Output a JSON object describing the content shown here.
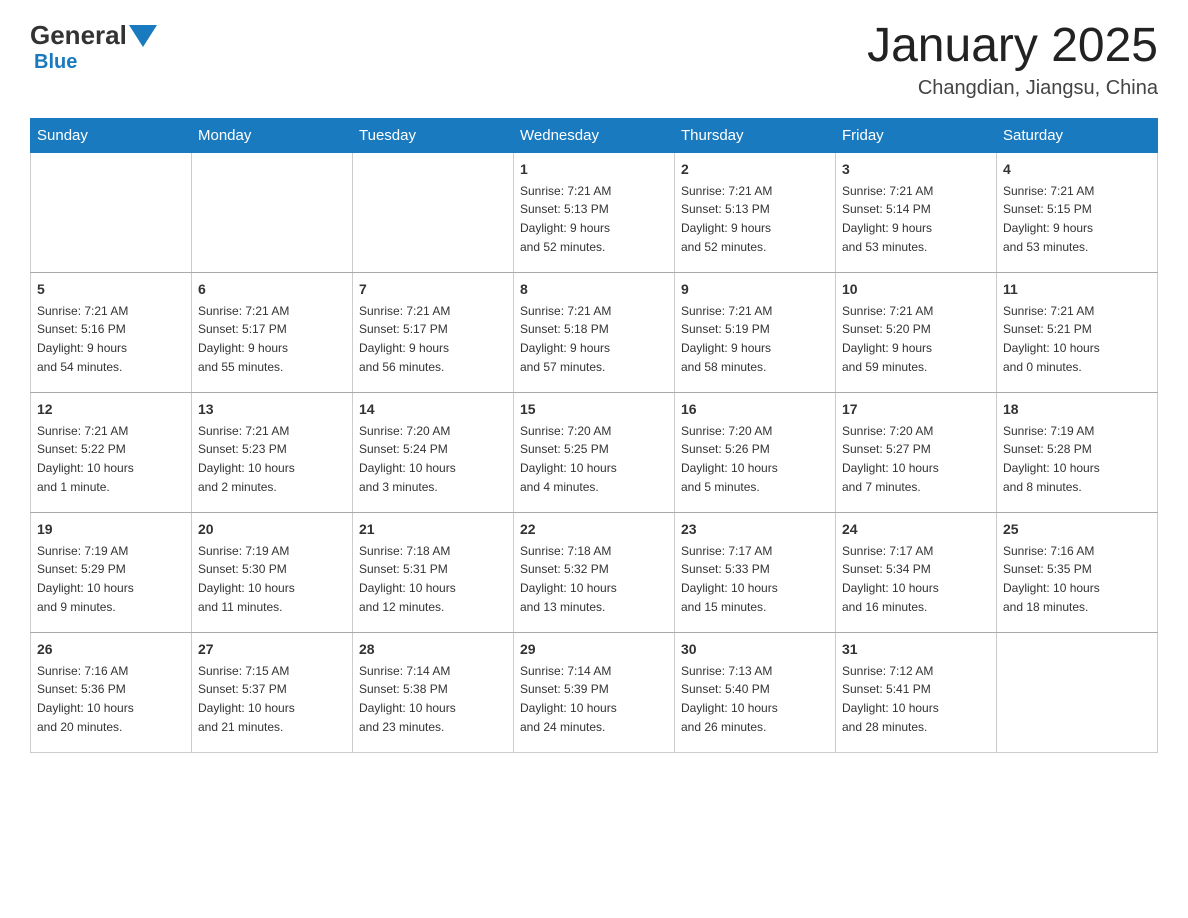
{
  "logo": {
    "text_general": "General",
    "text_blue": "Blue",
    "tagline": ""
  },
  "header": {
    "title": "January 2025",
    "subtitle": "Changdian, Jiangsu, China"
  },
  "days_of_week": [
    "Sunday",
    "Monday",
    "Tuesday",
    "Wednesday",
    "Thursday",
    "Friday",
    "Saturday"
  ],
  "weeks": [
    [
      {
        "day": "",
        "info": ""
      },
      {
        "day": "",
        "info": ""
      },
      {
        "day": "",
        "info": ""
      },
      {
        "day": "1",
        "info": "Sunrise: 7:21 AM\nSunset: 5:13 PM\nDaylight: 9 hours\nand 52 minutes."
      },
      {
        "day": "2",
        "info": "Sunrise: 7:21 AM\nSunset: 5:13 PM\nDaylight: 9 hours\nand 52 minutes."
      },
      {
        "day": "3",
        "info": "Sunrise: 7:21 AM\nSunset: 5:14 PM\nDaylight: 9 hours\nand 53 minutes."
      },
      {
        "day": "4",
        "info": "Sunrise: 7:21 AM\nSunset: 5:15 PM\nDaylight: 9 hours\nand 53 minutes."
      }
    ],
    [
      {
        "day": "5",
        "info": "Sunrise: 7:21 AM\nSunset: 5:16 PM\nDaylight: 9 hours\nand 54 minutes."
      },
      {
        "day": "6",
        "info": "Sunrise: 7:21 AM\nSunset: 5:17 PM\nDaylight: 9 hours\nand 55 minutes."
      },
      {
        "day": "7",
        "info": "Sunrise: 7:21 AM\nSunset: 5:17 PM\nDaylight: 9 hours\nand 56 minutes."
      },
      {
        "day": "8",
        "info": "Sunrise: 7:21 AM\nSunset: 5:18 PM\nDaylight: 9 hours\nand 57 minutes."
      },
      {
        "day": "9",
        "info": "Sunrise: 7:21 AM\nSunset: 5:19 PM\nDaylight: 9 hours\nand 58 minutes."
      },
      {
        "day": "10",
        "info": "Sunrise: 7:21 AM\nSunset: 5:20 PM\nDaylight: 9 hours\nand 59 minutes."
      },
      {
        "day": "11",
        "info": "Sunrise: 7:21 AM\nSunset: 5:21 PM\nDaylight: 10 hours\nand 0 minutes."
      }
    ],
    [
      {
        "day": "12",
        "info": "Sunrise: 7:21 AM\nSunset: 5:22 PM\nDaylight: 10 hours\nand 1 minute."
      },
      {
        "day": "13",
        "info": "Sunrise: 7:21 AM\nSunset: 5:23 PM\nDaylight: 10 hours\nand 2 minutes."
      },
      {
        "day": "14",
        "info": "Sunrise: 7:20 AM\nSunset: 5:24 PM\nDaylight: 10 hours\nand 3 minutes."
      },
      {
        "day": "15",
        "info": "Sunrise: 7:20 AM\nSunset: 5:25 PM\nDaylight: 10 hours\nand 4 minutes."
      },
      {
        "day": "16",
        "info": "Sunrise: 7:20 AM\nSunset: 5:26 PM\nDaylight: 10 hours\nand 5 minutes."
      },
      {
        "day": "17",
        "info": "Sunrise: 7:20 AM\nSunset: 5:27 PM\nDaylight: 10 hours\nand 7 minutes."
      },
      {
        "day": "18",
        "info": "Sunrise: 7:19 AM\nSunset: 5:28 PM\nDaylight: 10 hours\nand 8 minutes."
      }
    ],
    [
      {
        "day": "19",
        "info": "Sunrise: 7:19 AM\nSunset: 5:29 PM\nDaylight: 10 hours\nand 9 minutes."
      },
      {
        "day": "20",
        "info": "Sunrise: 7:19 AM\nSunset: 5:30 PM\nDaylight: 10 hours\nand 11 minutes."
      },
      {
        "day": "21",
        "info": "Sunrise: 7:18 AM\nSunset: 5:31 PM\nDaylight: 10 hours\nand 12 minutes."
      },
      {
        "day": "22",
        "info": "Sunrise: 7:18 AM\nSunset: 5:32 PM\nDaylight: 10 hours\nand 13 minutes."
      },
      {
        "day": "23",
        "info": "Sunrise: 7:17 AM\nSunset: 5:33 PM\nDaylight: 10 hours\nand 15 minutes."
      },
      {
        "day": "24",
        "info": "Sunrise: 7:17 AM\nSunset: 5:34 PM\nDaylight: 10 hours\nand 16 minutes."
      },
      {
        "day": "25",
        "info": "Sunrise: 7:16 AM\nSunset: 5:35 PM\nDaylight: 10 hours\nand 18 minutes."
      }
    ],
    [
      {
        "day": "26",
        "info": "Sunrise: 7:16 AM\nSunset: 5:36 PM\nDaylight: 10 hours\nand 20 minutes."
      },
      {
        "day": "27",
        "info": "Sunrise: 7:15 AM\nSunset: 5:37 PM\nDaylight: 10 hours\nand 21 minutes."
      },
      {
        "day": "28",
        "info": "Sunrise: 7:14 AM\nSunset: 5:38 PM\nDaylight: 10 hours\nand 23 minutes."
      },
      {
        "day": "29",
        "info": "Sunrise: 7:14 AM\nSunset: 5:39 PM\nDaylight: 10 hours\nand 24 minutes."
      },
      {
        "day": "30",
        "info": "Sunrise: 7:13 AM\nSunset: 5:40 PM\nDaylight: 10 hours\nand 26 minutes."
      },
      {
        "day": "31",
        "info": "Sunrise: 7:12 AM\nSunset: 5:41 PM\nDaylight: 10 hours\nand 28 minutes."
      },
      {
        "day": "",
        "info": ""
      }
    ]
  ]
}
